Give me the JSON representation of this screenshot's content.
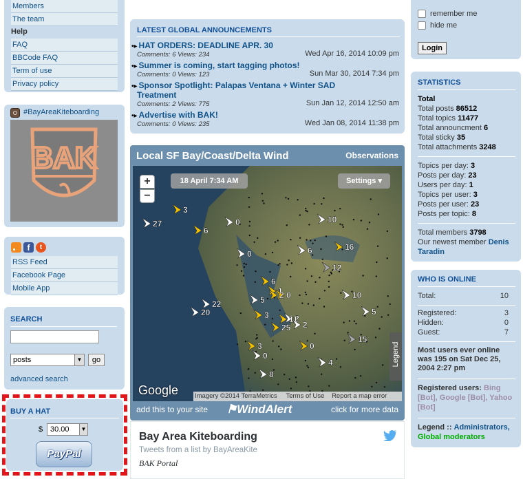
{
  "left": {
    "top_links": [
      "Members",
      "The team"
    ],
    "help_title": "Help",
    "help_links": [
      "FAQ",
      "BBCode FAQ",
      "Term of use",
      "Privacy policy"
    ],
    "instagram_tag": "#BayAreaKiteboarding",
    "logo_text": "BAK",
    "feed_links": [
      "RSS Feed",
      "Facebook Page",
      "Mobile App"
    ],
    "search_title": "SEARCH",
    "search_value": "",
    "search_select": "posts",
    "search_go": "go",
    "advanced_search": "advanced search",
    "hat_title": "BUY A HAT",
    "hat_currency": "$",
    "hat_price": "30.00",
    "paypal_label": "PayPal"
  },
  "announcements": {
    "title": "LATEST GLOBAL ANNOUNCEMENTS",
    "items": [
      {
        "title": "HAT ORDERS: DEADLINE APR. 30",
        "meta": "Comments: 6 Views: 234",
        "date": "Wed Apr 16, 2014 10:09 pm"
      },
      {
        "title": "Summer is coming, start tagging photos!",
        "meta": "Comments: 0 Views: 123",
        "date": "Sun Mar 30, 2014 7:34 pm"
      },
      {
        "title": "Sponsor Spotlight: Palapas Ventana + Winter SAD",
        "title2": "Treatment",
        "meta": "Comments: 2 Views: 775",
        "date": "Sun Jan 12, 2014 12:50 am"
      },
      {
        "title": "Advertise with BAK!",
        "meta": "Comments: 0 Views: 235",
        "date": "Wed Jan 08, 2014 11:38 pm"
      }
    ]
  },
  "wind": {
    "title": "Local SF Bay/Coast/Delta Wind",
    "observations": "Observations",
    "time": "18 April 7:34 AM",
    "settings": "Settings",
    "zoom_in": "+",
    "zoom_out": "−",
    "google": "Google",
    "imagery": "Imagery ©2014 TerraMetrics",
    "terms": "Terms of Use",
    "report": "Report a map error",
    "legend": "Legend",
    "add_site": "add this to your site",
    "brand": "WindAlert",
    "more_data": "click for more data",
    "labels": [
      "3",
      "27",
      "6",
      "0",
      "10",
      "16",
      "6",
      "12",
      "0",
      "6",
      "2",
      "1",
      "0",
      "2",
      "5",
      "22",
      "20",
      "3",
      "10",
      "5",
      "11",
      "2",
      "25",
      "15",
      "3",
      "0",
      "0",
      "4",
      "8"
    ]
  },
  "twitter": {
    "title": "Bay Area Kiteboarding",
    "subtitle": "Tweets from a list by BayAreaKite",
    "author": "BAK Portal"
  },
  "right": {
    "remember_me": "remember me",
    "hide_me": "hide me",
    "login": "Login",
    "stats_title": "STATISTICS",
    "total_label": "Total",
    "totals": [
      {
        "label": "Total posts",
        "value": "86512"
      },
      {
        "label": "Total topics",
        "value": "11477"
      },
      {
        "label": "Total announcment",
        "value": "6"
      },
      {
        "label": "Total sticky",
        "value": "35"
      },
      {
        "label": "Total attachments",
        "value": "3248"
      }
    ],
    "rates": [
      {
        "label": "Topics per day:",
        "value": "3"
      },
      {
        "label": "Posts per day:",
        "value": "23"
      },
      {
        "label": "Users per day:",
        "value": "1"
      },
      {
        "label": "Topics per user:",
        "value": "3"
      },
      {
        "label": "Posts per user:",
        "value": "23"
      },
      {
        "label": "Posts per topic:",
        "value": "8"
      }
    ],
    "members_label": "Total members",
    "members_value": "3798",
    "newest_label": "Our newest member",
    "newest_name": "Denis Taradin",
    "online_title": "WHO IS ONLINE",
    "online_total_label": "Total:",
    "online_total": "10",
    "registered_label": "Registered:",
    "registered": "3",
    "hidden_label": "Hidden:",
    "hidden": "0",
    "guest_label": "Guest:",
    "guest": "7",
    "most_users": "Most users ever online was 195 on Sat Dec 25, 2004 2:27 pm",
    "registered_users_label": "Registered users:",
    "registered_users": "Bing [Bot], Google [Bot], Yahoo [Bot]",
    "legend_label": "Legend ::",
    "legend_admins": "Administrators,",
    "legend_mods": "Global moderators"
  }
}
